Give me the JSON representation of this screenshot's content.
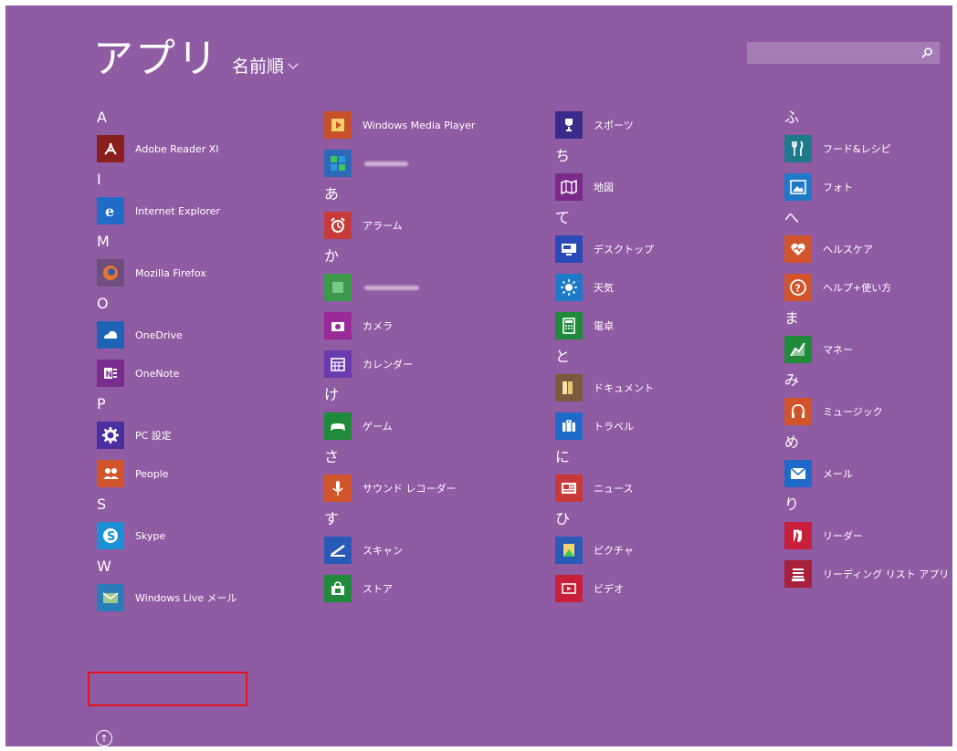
{
  "header": {
    "title": "アプリ",
    "sort_label": "名前順"
  },
  "search": {
    "placeholder": ""
  },
  "columns": [
    [
      {
        "type": "header",
        "label": "A"
      },
      {
        "type": "app",
        "name": "adobe-reader-xi",
        "label": "Adobe Reader XI",
        "color": "#8a1f1f",
        "icon": "adobe-icon"
      },
      {
        "type": "header",
        "label": "I"
      },
      {
        "type": "app",
        "name": "internet-explorer",
        "label": "Internet Explorer",
        "color": "#1f6cc8",
        "icon": "ie-icon"
      },
      {
        "type": "header",
        "label": "M"
      },
      {
        "type": "app",
        "name": "mozilla-firefox",
        "label": "Mozilla Firefox",
        "color": "#6e4e7d",
        "icon": "firefox-icon"
      },
      {
        "type": "header",
        "label": "O"
      },
      {
        "type": "app",
        "name": "onedrive",
        "label": "OneDrive",
        "color": "#1e63b8",
        "icon": "cloud-icon"
      },
      {
        "type": "app",
        "name": "onenote",
        "label": "OneNote",
        "color": "#7a2d8e",
        "icon": "onenote-icon"
      },
      {
        "type": "header",
        "label": "P"
      },
      {
        "type": "app",
        "name": "pc-settings",
        "label": "PC 設定",
        "color": "#4a2fa0",
        "icon": "gear-icon"
      },
      {
        "type": "app",
        "name": "people",
        "label": "People",
        "color": "#d2542a",
        "icon": "people-icon"
      },
      {
        "type": "header",
        "label": "S"
      },
      {
        "type": "app",
        "name": "skype",
        "label": "Skype",
        "color": "#1d8fd6",
        "icon": "skype-icon"
      },
      {
        "type": "header",
        "label": "W"
      },
      {
        "type": "app",
        "name": "windows-live-mail",
        "label": "Windows Live メール",
        "color": "#2a7db8",
        "icon": "mail-icon"
      }
    ],
    [
      {
        "type": "app",
        "name": "windows-media-player",
        "label": "Windows Media Player",
        "color": "#c8502a",
        "icon": "play-icon"
      },
      {
        "type": "app",
        "name": "blurred-app-1",
        "label": "",
        "color": "#2b6ab8",
        "icon": "windows-icon",
        "blurred": true,
        "blur_width": 48
      },
      {
        "type": "header",
        "label": "あ"
      },
      {
        "type": "app",
        "name": "alarm",
        "label": "アラーム",
        "color": "#c83a3a",
        "icon": "alarm-icon"
      },
      {
        "type": "header",
        "label": "か"
      },
      {
        "type": "app",
        "name": "blurred-app-2",
        "label": "",
        "color": "#3a9a4a",
        "icon": "app-icon",
        "blurred": true,
        "blur_width": 60
      },
      {
        "type": "app",
        "name": "camera",
        "label": "カメラ",
        "color": "#9a2a9a",
        "icon": "camera-icon"
      },
      {
        "type": "app",
        "name": "calendar",
        "label": "カレンダー",
        "color": "#6a3ab0",
        "icon": "calendar-icon"
      },
      {
        "type": "header",
        "label": "け"
      },
      {
        "type": "app",
        "name": "game",
        "label": "ゲーム",
        "color": "#1e8a3a",
        "icon": "gamepad-icon"
      },
      {
        "type": "header",
        "label": "さ"
      },
      {
        "type": "app",
        "name": "sound-recorder",
        "label": "サウンド レコーダー",
        "color": "#d2542a",
        "icon": "mic-icon"
      },
      {
        "type": "header",
        "label": "す"
      },
      {
        "type": "app",
        "name": "scan",
        "label": "スキャン",
        "color": "#2a5ab8",
        "icon": "scan-icon"
      },
      {
        "type": "app",
        "name": "store",
        "label": "ストア",
        "color": "#1e8a3a",
        "icon": "store-icon"
      }
    ],
    [
      {
        "type": "app",
        "name": "sports",
        "label": "スポーツ",
        "color": "#3a2a8a",
        "icon": "trophy-icon"
      },
      {
        "type": "header",
        "label": "ち"
      },
      {
        "type": "app",
        "name": "maps",
        "label": "地図",
        "color": "#7a2a8a",
        "icon": "map-icon"
      },
      {
        "type": "header",
        "label": "て"
      },
      {
        "type": "app",
        "name": "desktop",
        "label": "デスクトップ",
        "color": "#2a4ab8",
        "icon": "desktop-icon"
      },
      {
        "type": "app",
        "name": "weather",
        "label": "天気",
        "color": "#1e7ac8",
        "icon": "sun-icon"
      },
      {
        "type": "app",
        "name": "calculator",
        "label": "電卓",
        "color": "#1e8a3a",
        "icon": "calculator-icon"
      },
      {
        "type": "header",
        "label": "と"
      },
      {
        "type": "app",
        "name": "documents",
        "label": "ドキュメント",
        "color": "#7a5a3a",
        "icon": "folder-icon"
      },
      {
        "type": "app",
        "name": "travel",
        "label": "トラベル",
        "color": "#1e6ac8",
        "icon": "suitcase-icon"
      },
      {
        "type": "header",
        "label": "に"
      },
      {
        "type": "app",
        "name": "news",
        "label": "ニュース",
        "color": "#c83a3a",
        "icon": "news-icon"
      },
      {
        "type": "header",
        "label": "ひ"
      },
      {
        "type": "app",
        "name": "pictures",
        "label": "ピクチャ",
        "color": "#2a5ab8",
        "icon": "pictures-icon"
      },
      {
        "type": "app",
        "name": "video",
        "label": "ビデオ",
        "color": "#c8203a",
        "icon": "video-icon"
      }
    ],
    [
      {
        "type": "header",
        "label": "ふ"
      },
      {
        "type": "app",
        "name": "food-and-drink",
        "label": "フード&レシピ",
        "color": "#1e7a8a",
        "icon": "fork-icon"
      },
      {
        "type": "app",
        "name": "photos",
        "label": "フォト",
        "color": "#1e7ac8",
        "icon": "photo-icon"
      },
      {
        "type": "header",
        "label": "へ"
      },
      {
        "type": "app",
        "name": "health",
        "label": "ヘルスケア",
        "color": "#d2542a",
        "icon": "heart-icon"
      },
      {
        "type": "app",
        "name": "help-tips",
        "label": "ヘルプ+使い方",
        "color": "#d2542a",
        "icon": "help-icon"
      },
      {
        "type": "header",
        "label": "ま"
      },
      {
        "type": "app",
        "name": "money",
        "label": "マネー",
        "color": "#1e8a3a",
        "icon": "chart-icon"
      },
      {
        "type": "header",
        "label": "み"
      },
      {
        "type": "app",
        "name": "music",
        "label": "ミュージック",
        "color": "#d2542a",
        "icon": "headphones-icon"
      },
      {
        "type": "header",
        "label": "め"
      },
      {
        "type": "app",
        "name": "mail",
        "label": "メール",
        "color": "#1e6ac8",
        "icon": "envelope-icon"
      },
      {
        "type": "header",
        "label": "り"
      },
      {
        "type": "app",
        "name": "reader",
        "label": "リーダー",
        "color": "#c8203a",
        "icon": "reader-icon"
      },
      {
        "type": "app",
        "name": "reading-list",
        "label": "リーディング リスト アプリ",
        "color": "#a8203a",
        "icon": "list-icon"
      }
    ]
  ],
  "highlighted_app": "Windows Live メール",
  "colors": {
    "background": "#8f5ba3",
    "highlight_border": "#e3141e"
  }
}
